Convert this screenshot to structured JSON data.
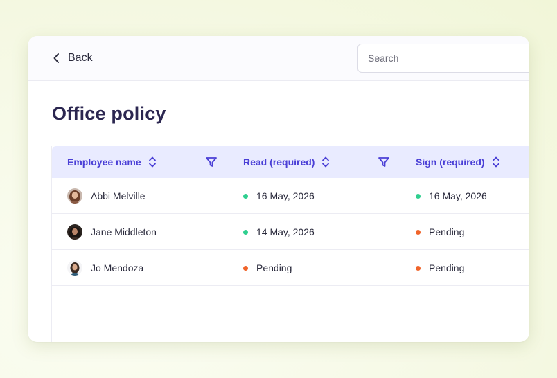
{
  "header": {
    "back_label": "Back",
    "search_placeholder": "Search"
  },
  "page": {
    "title": "Office policy"
  },
  "table": {
    "columns": [
      {
        "label": "Employee name",
        "sortable": true,
        "filterable": true
      },
      {
        "label": "Read (required)",
        "sortable": true,
        "filterable": true
      },
      {
        "label": "Sign (required)",
        "sortable": true,
        "filterable": false
      }
    ],
    "rows": [
      {
        "name": "Abbi Melville",
        "read": {
          "text": "16 May, 2026",
          "status": "done"
        },
        "sign": {
          "text": "16 May, 2026",
          "status": "done"
        }
      },
      {
        "name": "Jane Middleton",
        "read": {
          "text": "14 May, 2026",
          "status": "done"
        },
        "sign": {
          "text": "Pending",
          "status": "pending"
        }
      },
      {
        "name": "Jo Mendoza",
        "read": {
          "text": "Pending",
          "status": "pending"
        },
        "sign": {
          "text": "Pending",
          "status": "pending"
        }
      }
    ]
  },
  "colors": {
    "accent": "#4a3fd6",
    "header_bg": "#e9ebff",
    "status_done": "#2fcf8f",
    "status_pending": "#f0642a",
    "title": "#2b2650"
  },
  "icons": {
    "back": "chevron-left-icon",
    "sort": "sort-updown-icon",
    "filter": "filter-funnel-icon",
    "avatar": "avatar-photo"
  }
}
